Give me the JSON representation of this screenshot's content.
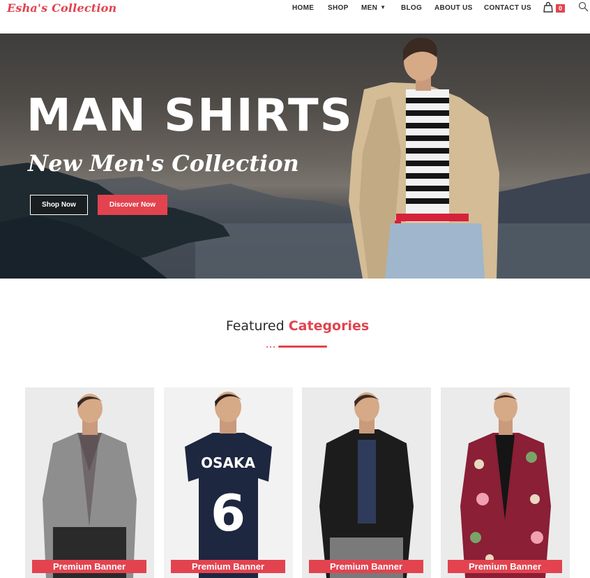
{
  "brand": {
    "logo_text": "Esha's Collection",
    "accent_color": "#e2434f"
  },
  "nav": {
    "items": [
      "HOME",
      "SHOP",
      "MEN",
      "BLOG",
      "ABOUT US",
      "CONTACT US"
    ],
    "cart_icon": "shopping-bag-icon",
    "cart_count": "0",
    "search_icon": "search-icon"
  },
  "hero": {
    "title": "MAN SHIRTS",
    "subtitle": "New Men's Collection",
    "primary_button": "Shop Now",
    "secondary_button": "Discover Now"
  },
  "featured": {
    "title_plain": "Featured",
    "title_accent": "Categories"
  },
  "categories": [
    {
      "label": "Premium Banner"
    },
    {
      "label": "Premium Banner"
    },
    {
      "label": "Premium Banner"
    },
    {
      "label": "Premium Banner"
    }
  ]
}
